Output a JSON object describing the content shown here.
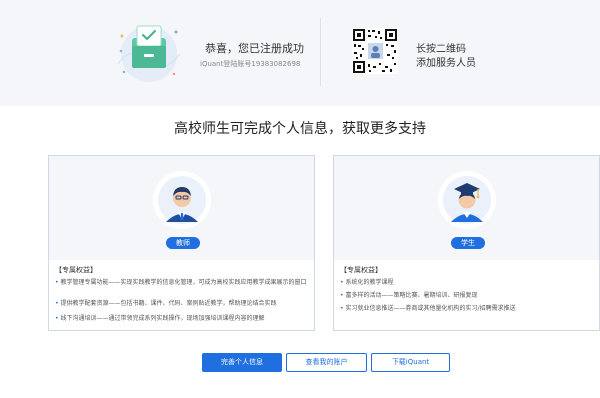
{
  "header": {
    "success_title": "恭喜，您已注册成功",
    "success_sub": "iQuant登陆账号19383082698",
    "qr_line1": "长按二维码",
    "qr_line2": "添加服务人员"
  },
  "main": {
    "title": "高校师生可完成个人信息，获取更多支持"
  },
  "cards": [
    {
      "role": "教师",
      "benefit_title": "【专属权益】",
      "benefits": [
        "教学管理专属功能——实现实践教学的信息化管理，可成为高校实践应用教学成果展示的窗口",
        "提供教学配套资源——包括书籍、课件、代码、案例贴近教学，帮助理论结合实践",
        "线下沟通培训——通过带领完成系列实践操作，现场加强培训课程内容的理解"
      ]
    },
    {
      "role": "学生",
      "benefit_title": "【专属权益】",
      "benefits": [
        "系统化的教学课程",
        "富多样的活动——策略比赛、暑期培训、研报复现",
        "实习就业信息推送——券商或其他量化机构的实习/招聘需求推送"
      ]
    }
  ],
  "buttons": {
    "complete": "完善个人信息",
    "account": "查看我的账户",
    "download": "下载iQuant"
  },
  "colors": {
    "accent": "#1f6fe0",
    "band": "#f4f6f9"
  }
}
